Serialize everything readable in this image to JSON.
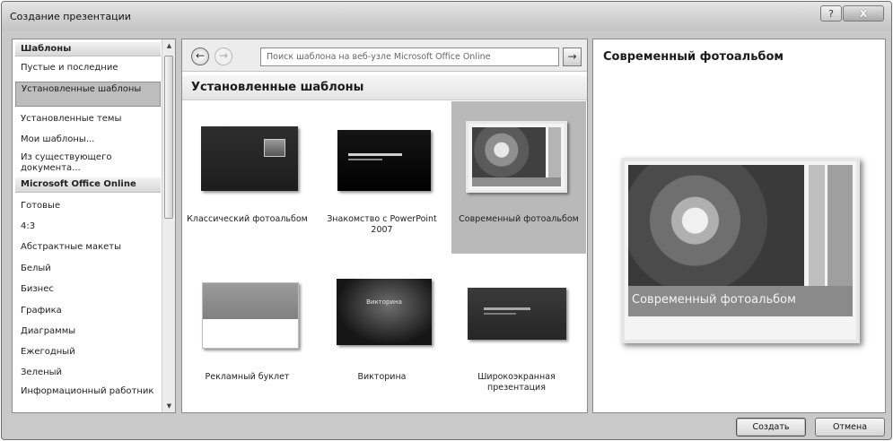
{
  "window": {
    "title": "Создание презентации",
    "help_label": "?",
    "close_label": "X"
  },
  "sidebar": {
    "items": [
      {
        "label": "Шаблоны"
      },
      {
        "label": "Пустые и последние"
      },
      {
        "label": "Установленные шаблоны"
      },
      {
        "label": "Установленные темы"
      },
      {
        "label": "Мои шаблоны..."
      },
      {
        "label": "Из существующего документа..."
      },
      {
        "label": "Microsoft Office Online"
      },
      {
        "label": "Готовые"
      },
      {
        "label": "4:3"
      },
      {
        "label": "Абстрактные макеты"
      },
      {
        "label": "Белый"
      },
      {
        "label": "Бизнес"
      },
      {
        "label": "Графика"
      },
      {
        "label": "Диаграммы"
      },
      {
        "label": "Ежегодный"
      },
      {
        "label": "Зеленый"
      },
      {
        "label": "Информационный работник"
      }
    ]
  },
  "toolbar": {
    "search_text": "Поиск шаблона на веб-узле Microsoft Office Online",
    "go_label": "→",
    "back_label": "←",
    "forward_label": "→"
  },
  "main": {
    "section_title": "Установленные шаблоны",
    "templates": [
      {
        "label": "Классический фотоальбом"
      },
      {
        "label": "Знакомство с PowerPoint 2007"
      },
      {
        "label": "Современный фотоальбом"
      },
      {
        "label": "Рекламный буклет"
      },
      {
        "label": "Викторина"
      },
      {
        "label": "Широкоэкранная презентация"
      }
    ],
    "quiz_thumb_text": "Викторина"
  },
  "preview": {
    "title": "Современный фотоальбом",
    "caption": "Современный фотоальбом"
  },
  "buttons": {
    "create": "Создать",
    "cancel": "Отмена"
  }
}
